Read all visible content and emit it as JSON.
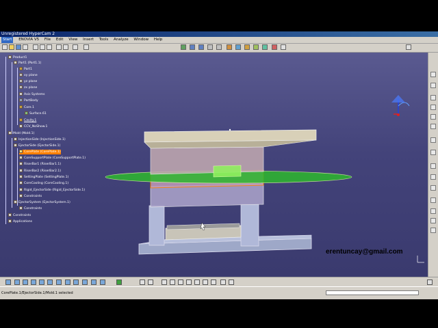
{
  "window": {
    "title": "Unregistered HyperCam 2"
  },
  "menu": {
    "items": [
      "Start",
      "ENOVIA V5",
      "File",
      "Edit",
      "View",
      "Insert",
      "Tools",
      "Analyze",
      "Window",
      "Help"
    ]
  },
  "tree": {
    "root": "Product1",
    "part1": "Part1 (Part1.1)",
    "part1_body": "Part1",
    "xy_plane": "xy plane",
    "yz_plane": "yz plane",
    "zx_plane": "zx plane",
    "axis_systems": "Axis Systems",
    "partbody": "PartBody",
    "core1": "Core.1",
    "surface": "Surface.61",
    "cavity": "Cavity.1",
    "ccv": "CCV_NoShow.1",
    "mold": "Mold (Mold.1)",
    "injection_side": "InjectionSide (InjectionSide.1)",
    "ejector_side": "EjectorSide (EjectorSide.1)",
    "core_plate": "CorePlate (CorePlate.1)",
    "core_support": "CoreSupportPlate (CoreSupportPlate.1)",
    "riserbar1": "RiserBar1 (RiserBar1.1)",
    "riserbar2": "RiserBar2 (RiserBar2.1)",
    "setting_plate": "SettingPlate (SettingPlate.1)",
    "core_cooling": "CoreCooling (CoreCooling.1)",
    "rigid_ejector": "Rigid_EjectorSide (Rigid_EjectorSide.1)",
    "constraints_inner": "Constraints",
    "ejector_system": "EjectorSystem (EjectorSystem.1)",
    "constraints_inner2": "Constraints",
    "constraints": "Constraints",
    "applications": "Applications"
  },
  "status": {
    "text": "CorePlate.1/EjectorSide.1/Mold.1 selected"
  },
  "watermark": {
    "email": "erentuncay@gmail.com"
  },
  "colors": {
    "viewport_top": "#5a5a90",
    "viewport_bottom": "#3a3a6e",
    "selection": "#ff8000",
    "titlebar": "#0a246a"
  }
}
